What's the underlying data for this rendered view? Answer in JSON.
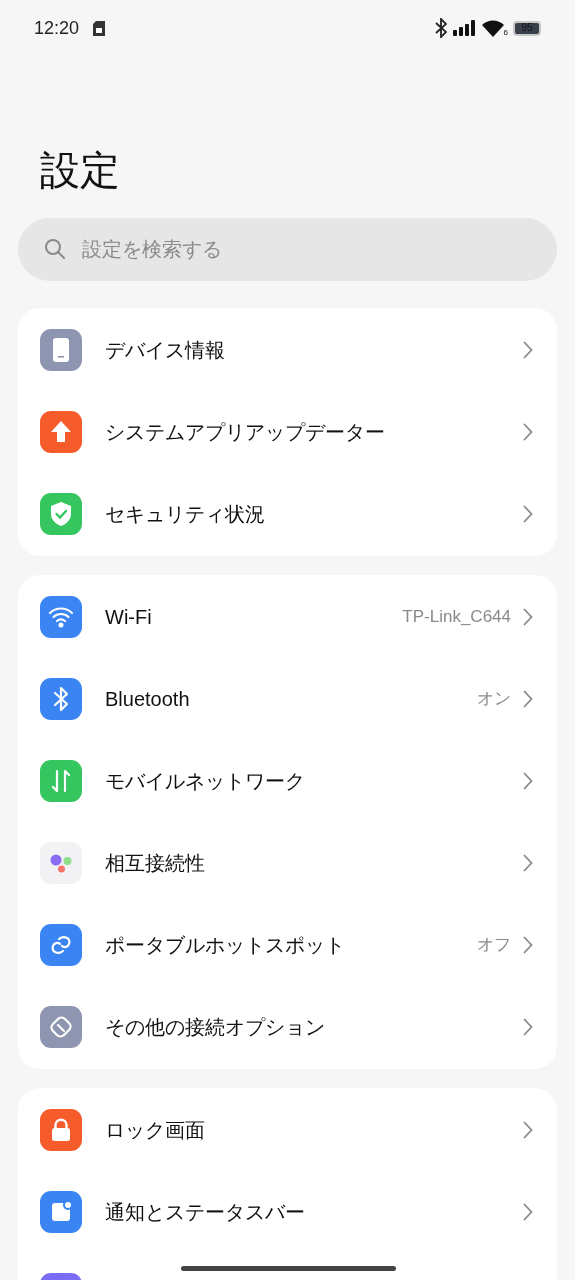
{
  "status_bar": {
    "time": "12:20",
    "wifi_badge": "6",
    "battery": "95"
  },
  "title": "設定",
  "search": {
    "placeholder": "設定を検索する"
  },
  "groups": [
    {
      "items": [
        {
          "label": "デバイス情報",
          "kind": "phone",
          "color": "#8e95b0"
        },
        {
          "label": "システムアプリアップデーター",
          "kind": "upload",
          "color": "#f65b2c"
        },
        {
          "label": "セキュリティ状況",
          "kind": "shield",
          "color": "#35c65f"
        }
      ]
    },
    {
      "items": [
        {
          "label": "Wi-Fi",
          "value": "TP-Link_C644",
          "kind": "wifi",
          "color": "#3a84f3"
        },
        {
          "label": "Bluetooth",
          "value": "オン",
          "kind": "bluetooth",
          "color": "#3a84f3"
        },
        {
          "label": "モバイルネットワーク",
          "kind": "arrows",
          "color": "#35c65f"
        },
        {
          "label": "相互接続性",
          "kind": "dots",
          "color": "#f2f2f4"
        },
        {
          "label": "ポータブルホットスポット",
          "value": "オフ",
          "kind": "link",
          "color": "#3a84f3"
        },
        {
          "label": "その他の接続オプション",
          "kind": "chain",
          "color": "#8e95b0"
        }
      ]
    },
    {
      "items": [
        {
          "label": "ロック画面",
          "kind": "lock",
          "color": "#f65b2c"
        },
        {
          "label": "通知とステータスバー",
          "kind": "notify",
          "color": "#3a84f3"
        },
        {
          "kind": "blank",
          "color": "#7b6cf6"
        }
      ]
    }
  ]
}
